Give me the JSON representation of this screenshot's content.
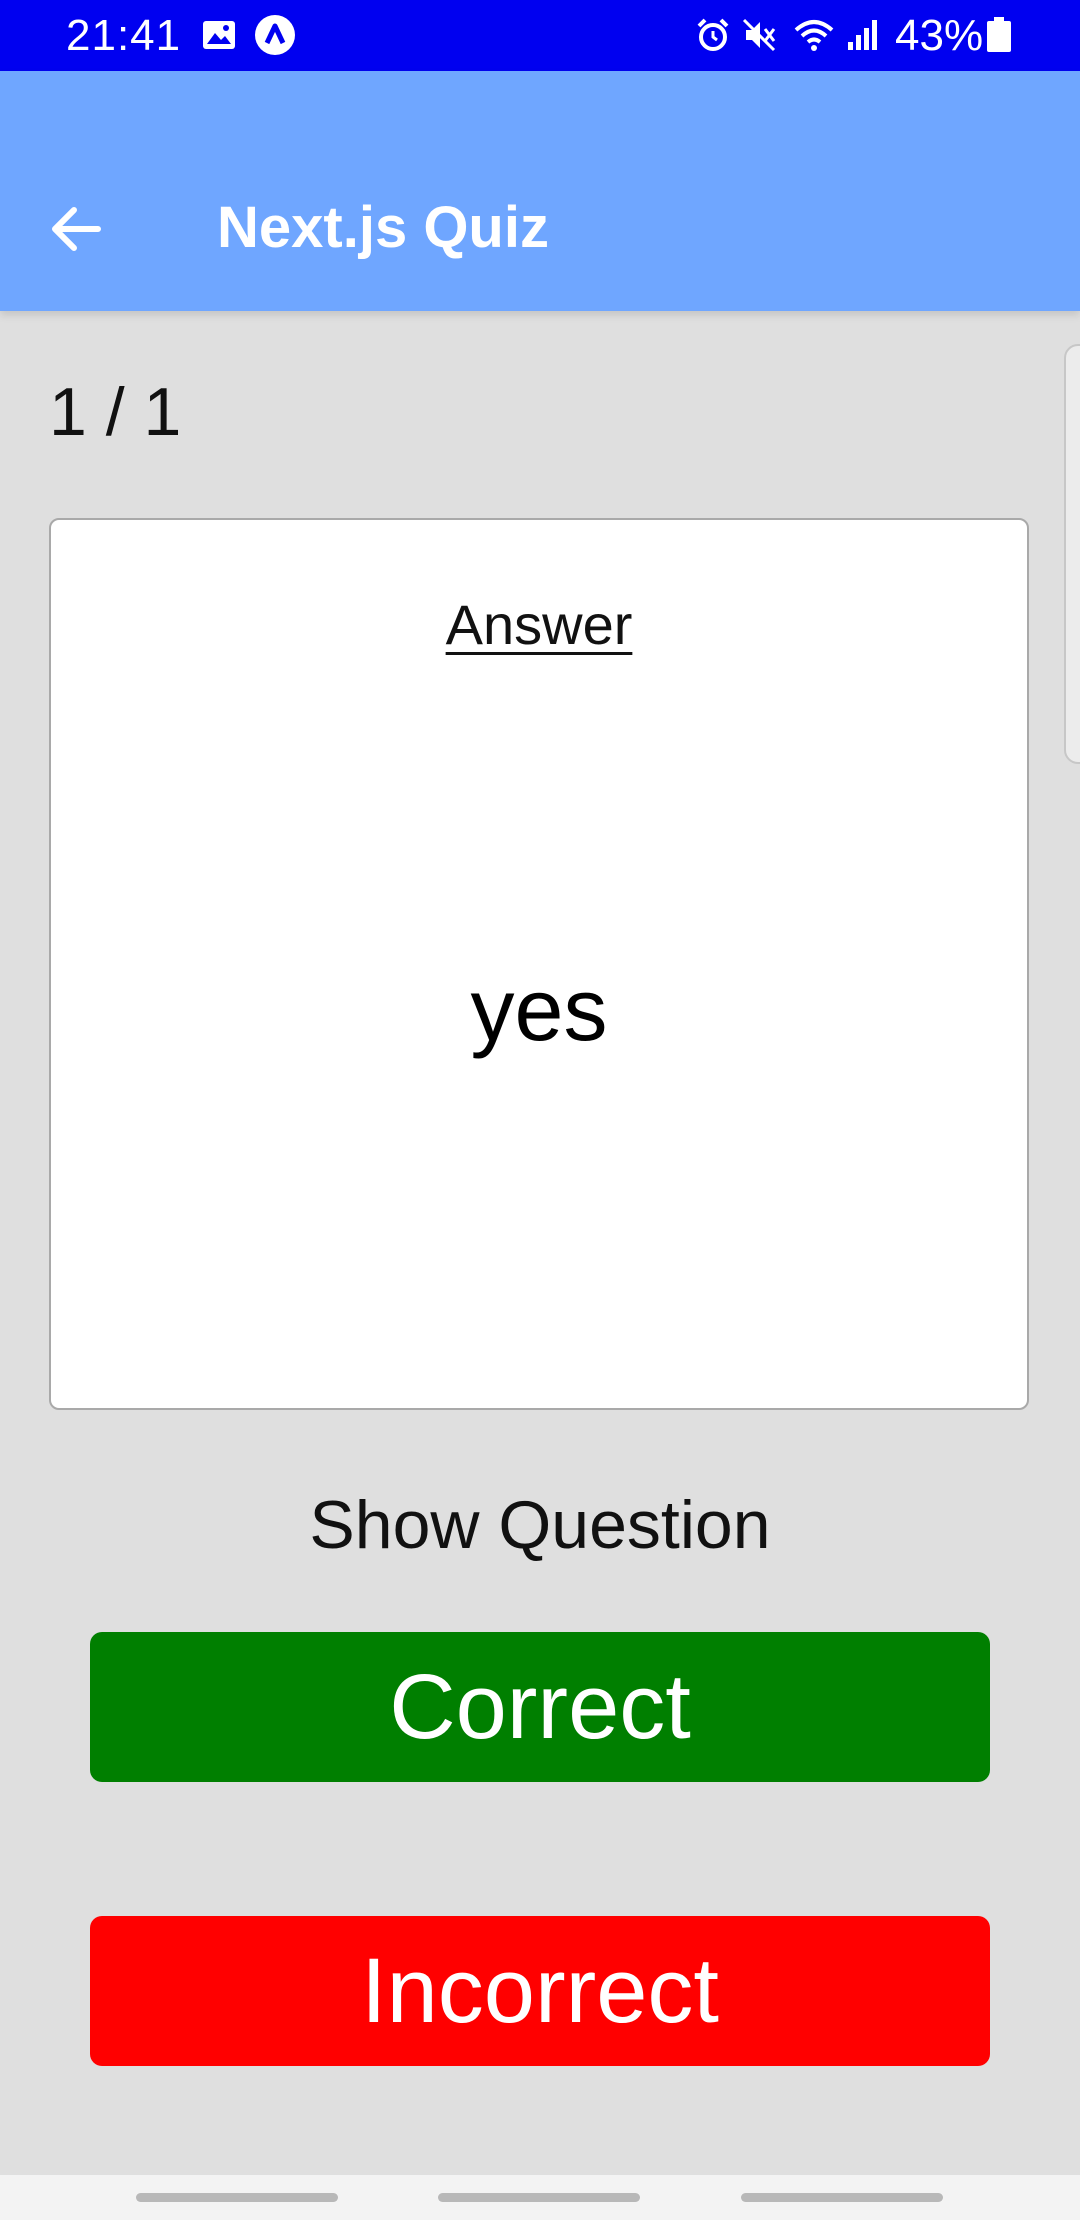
{
  "status_bar": {
    "time": "21:41",
    "battery": "43%",
    "left_icons": [
      "image-icon",
      "app-a-icon"
    ],
    "right_icons": [
      "alarm-icon",
      "mute-icon",
      "wifi-icon",
      "signal-icon",
      "battery-icon"
    ],
    "background": "#0000f0"
  },
  "app_bar": {
    "title": "Next.js Quiz",
    "back_icon": "arrow-left-icon",
    "background": "#6fa6ff"
  },
  "quiz": {
    "progress": "1 / 1",
    "card": {
      "heading": "Answer",
      "content": "yes"
    },
    "toggle_label": "Show Question",
    "correct_label": "Correct",
    "incorrect_label": "Incorrect",
    "correct_color": "#007f00",
    "incorrect_color": "#ff0000"
  }
}
